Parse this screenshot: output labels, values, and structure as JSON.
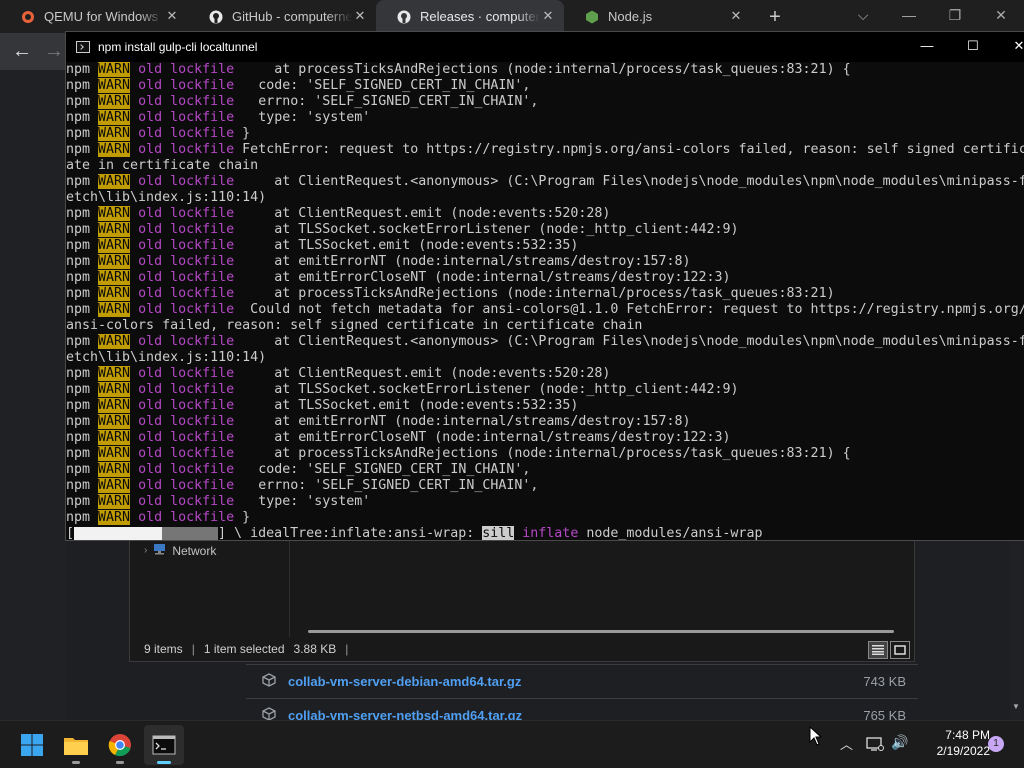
{
  "browser": {
    "tabs": [
      {
        "label": "QEMU for Windows – I",
        "icon": "qemu-icon"
      },
      {
        "label": "GitHub - computernew",
        "icon": "github-icon"
      },
      {
        "label": "Releases · computerne",
        "icon": "github-icon",
        "active": true
      },
      {
        "label": "Node.js",
        "icon": "nodejs-icon"
      }
    ],
    "close_glyph": "✕",
    "new_tab_glyph": "+",
    "window_controls": {
      "dropdown": "⌵",
      "minimize": "—",
      "restore": "❐",
      "close": "✕"
    },
    "nav": {
      "back": "←",
      "forward": "→"
    }
  },
  "explorer": {
    "nav_item": "Network",
    "status": {
      "items": "9 items",
      "selected": "1 item selected",
      "size": "3.88 KB",
      "sep": "|"
    }
  },
  "downloads": [
    {
      "name": "collab-vm-server-debian-amd64.tar.gz",
      "size": "743 KB"
    },
    {
      "name": "collab-vm-server-netbsd-amd64.tar.gz",
      "size": "765 KB"
    }
  ],
  "console": {
    "title": "npm install gulp-cli localtunnel",
    "controls": {
      "minimize": "—",
      "maximize": "☐",
      "close": "✕"
    },
    "prefix": {
      "npm": "npm ",
      "warn": "WARN",
      "old": "old",
      "lockfile": "lockfile"
    },
    "lines": [
      {
        "t": "w",
        "text": "     at processTicksAndRejections (node:internal/process/task_queues:83:21) {"
      },
      {
        "t": "w",
        "text": "   code: 'SELF_SIGNED_CERT_IN_CHAIN',"
      },
      {
        "t": "w",
        "text": "   errno: 'SELF_SIGNED_CERT_IN_CHAIN',"
      },
      {
        "t": "w",
        "text": "   type: 'system'"
      },
      {
        "t": "w",
        "text": " }"
      },
      {
        "t": "w",
        "text": " FetchError: request to https://registry.npmjs.org/ansi-colors failed, reason: self signed certific"
      },
      {
        "t": "p",
        "text": "ate in certificate chain"
      },
      {
        "t": "w",
        "text": "     at ClientRequest.<anonymous> (C:\\Program Files\\nodejs\\node_modules\\npm\\node_modules\\minipass-f"
      },
      {
        "t": "p",
        "text": "etch\\lib\\index.js:110:14)"
      },
      {
        "t": "w",
        "text": "     at ClientRequest.emit (node:events:520:28)"
      },
      {
        "t": "w",
        "text": "     at TLSSocket.socketErrorListener (node:_http_client:442:9)"
      },
      {
        "t": "w",
        "text": "     at TLSSocket.emit (node:events:532:35)"
      },
      {
        "t": "w",
        "text": "     at emitErrorNT (node:internal/streams/destroy:157:8)"
      },
      {
        "t": "w",
        "text": "     at emitErrorCloseNT (node:internal/streams/destroy:122:3)"
      },
      {
        "t": "w",
        "text": "     at processTicksAndRejections (node:internal/process/task_queues:83:21)"
      },
      {
        "t": "w",
        "text": "  Could not fetch metadata for ansi-colors@1.1.0 FetchError: request to https://registry.npmjs.org/"
      },
      {
        "t": "p",
        "text": "ansi-colors failed, reason: self signed certificate in certificate chain"
      },
      {
        "t": "w",
        "text": "     at ClientRequest.<anonymous> (C:\\Program Files\\nodejs\\node_modules\\npm\\node_modules\\minipass-f"
      },
      {
        "t": "p",
        "text": "etch\\lib\\index.js:110:14)"
      },
      {
        "t": "w",
        "text": "     at ClientRequest.emit (node:events:520:28)"
      },
      {
        "t": "w",
        "text": "     at TLSSocket.socketErrorListener (node:_http_client:442:9)"
      },
      {
        "t": "w",
        "text": "     at TLSSocket.emit (node:events:532:35)"
      },
      {
        "t": "w",
        "text": "     at emitErrorNT (node:internal/streams/destroy:157:8)"
      },
      {
        "t": "w",
        "text": "     at emitErrorCloseNT (node:internal/streams/destroy:122:3)"
      },
      {
        "t": "w",
        "text": "     at processTicksAndRejections (node:internal/process/task_queues:83:21) {"
      },
      {
        "t": "w",
        "text": "   code: 'SELF_SIGNED_CERT_IN_CHAIN',"
      },
      {
        "t": "w",
        "text": "   errno: 'SELF_SIGNED_CERT_IN_CHAIN',"
      },
      {
        "t": "w",
        "text": "   type: 'system'"
      },
      {
        "t": "w",
        "text": " }"
      }
    ],
    "progress": {
      "open": "[",
      "close": "]",
      "fraction": 0.61,
      "spinner": " \\ ",
      "stage": "idealTree:inflate:ansi-wrap: ",
      "level": "sill",
      "action": "inflate",
      "path": " node_modules/ansi-wrap"
    }
  },
  "taskbar": {
    "apps": [
      "windows-start-icon",
      "file-explorer-icon",
      "chrome-icon",
      "terminal-icon"
    ],
    "time": "7:48 PM",
    "date": "2/19/2022",
    "notifications": "1",
    "tray_chevron": "︿",
    "speaker": "🔊"
  },
  "colors": {
    "warn_bg": "#c19c00",
    "magenta": "#b548c6",
    "link_blue": "#4f9ff2"
  }
}
